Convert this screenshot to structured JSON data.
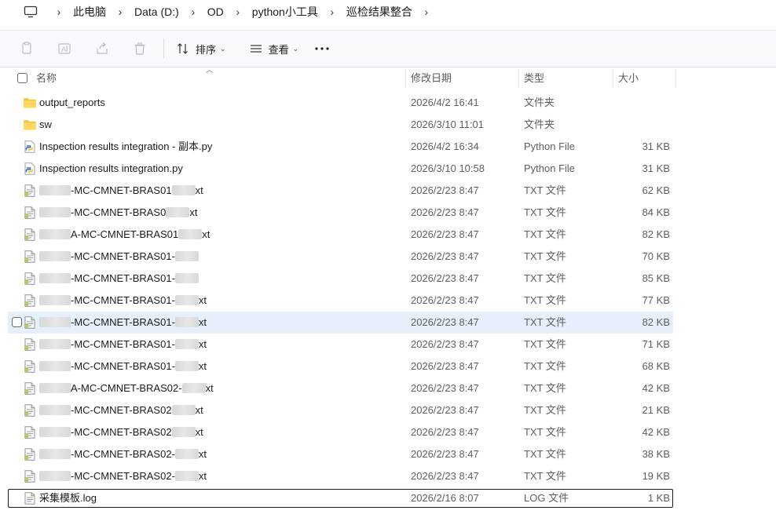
{
  "breadcrumb": {
    "items": [
      "此电脑",
      "Data (D:)",
      "OD",
      "python小工具",
      "巡检结果整合"
    ],
    "separator": "›"
  },
  "toolbar": {
    "sort_label": "排序",
    "view_label": "查看",
    "more_label": "…"
  },
  "columns": {
    "name": "名称",
    "date": "修改日期",
    "type": "类型",
    "size": "大小"
  },
  "files": [
    {
      "icon": "folder",
      "name": "output_reports",
      "date": "2026/4/2 16:41",
      "type": "文件夹",
      "size": ""
    },
    {
      "icon": "folder",
      "name": "sw",
      "date": "2026/3/10 11:01",
      "type": "文件夹",
      "size": ""
    },
    {
      "icon": "python",
      "name": "Inspection results integration - 副本.py",
      "date": "2026/4/2 16:34",
      "type": "Python File",
      "size": "31 KB"
    },
    {
      "icon": "python",
      "name": "Inspection results integration.py",
      "date": "2026/3/10 10:58",
      "type": "Python File",
      "size": "31 KB"
    },
    {
      "icon": "txt",
      "name": "-MC-CMNET-BRAS01",
      "suffix": "xt",
      "date": "2026/2/23 8:47",
      "type": "TXT 文件",
      "size": "62 KB"
    },
    {
      "icon": "txt",
      "name": "-MC-CMNET-BRAS0",
      "suffix": "xt",
      "date": "2026/2/23 8:47",
      "type": "TXT 文件",
      "size": "84 KB"
    },
    {
      "icon": "txt",
      "name": "A-MC-CMNET-BRAS01",
      "suffix": "xt",
      "date": "2026/2/23 8:47",
      "type": "TXT 文件",
      "size": "82 KB"
    },
    {
      "icon": "txt",
      "name": "-MC-CMNET-BRAS01-",
      "suffix": "",
      "date": "2026/2/23 8:47",
      "type": "TXT 文件",
      "size": "70 KB"
    },
    {
      "icon": "txt",
      "name": "-MC-CMNET-BRAS01-",
      "suffix": "",
      "date": "2026/2/23 8:47",
      "type": "TXT 文件",
      "size": "85 KB"
    },
    {
      "icon": "txt",
      "name": "-MC-CMNET-BRAS01-",
      "suffix": "xt",
      "date": "2026/2/23 8:47",
      "type": "TXT 文件",
      "size": "77 KB"
    },
    {
      "icon": "txt",
      "name": "-MC-CMNET-BRAS01-",
      "suffix": "xt",
      "date": "2026/2/23 8:47",
      "type": "TXT 文件",
      "size": "82 KB",
      "selected": true
    },
    {
      "icon": "txt",
      "name": "-MC-CMNET-BRAS01-",
      "suffix": "xt",
      "date": "2026/2/23 8:47",
      "type": "TXT 文件",
      "size": "71 KB"
    },
    {
      "icon": "txt",
      "name": "-MC-CMNET-BRAS01-",
      "suffix": "xt",
      "date": "2026/2/23 8:47",
      "type": "TXT 文件",
      "size": "68 KB"
    },
    {
      "icon": "txt",
      "name": "A-MC-CMNET-BRAS02-",
      "suffix": "xt",
      "date": "2026/2/23 8:47",
      "type": "TXT 文件",
      "size": "42 KB"
    },
    {
      "icon": "txt",
      "name": "-MC-CMNET-BRAS02",
      "suffix": "xt",
      "date": "2026/2/23 8:47",
      "type": "TXT 文件",
      "size": "21 KB"
    },
    {
      "icon": "txt",
      "name": "-MC-CMNET-BRAS02",
      "suffix": "xt",
      "date": "2026/2/23 8:47",
      "type": "TXT 文件",
      "size": "42 KB"
    },
    {
      "icon": "txt",
      "name": "-MC-CMNET-BRAS02-",
      "suffix": "xt",
      "date": "2026/2/23 8:47",
      "type": "TXT 文件",
      "size": "38 KB"
    },
    {
      "icon": "txt",
      "name": "-MC-CMNET-BRAS02-",
      "suffix": "xt",
      "date": "2026/2/23 8:47",
      "type": "TXT 文件",
      "size": "19 KB"
    },
    {
      "icon": "log",
      "name": "采集模板.log",
      "date": "2026/2/16 8:07",
      "type": "LOG 文件",
      "size": "1 KB",
      "focused": true
    }
  ]
}
